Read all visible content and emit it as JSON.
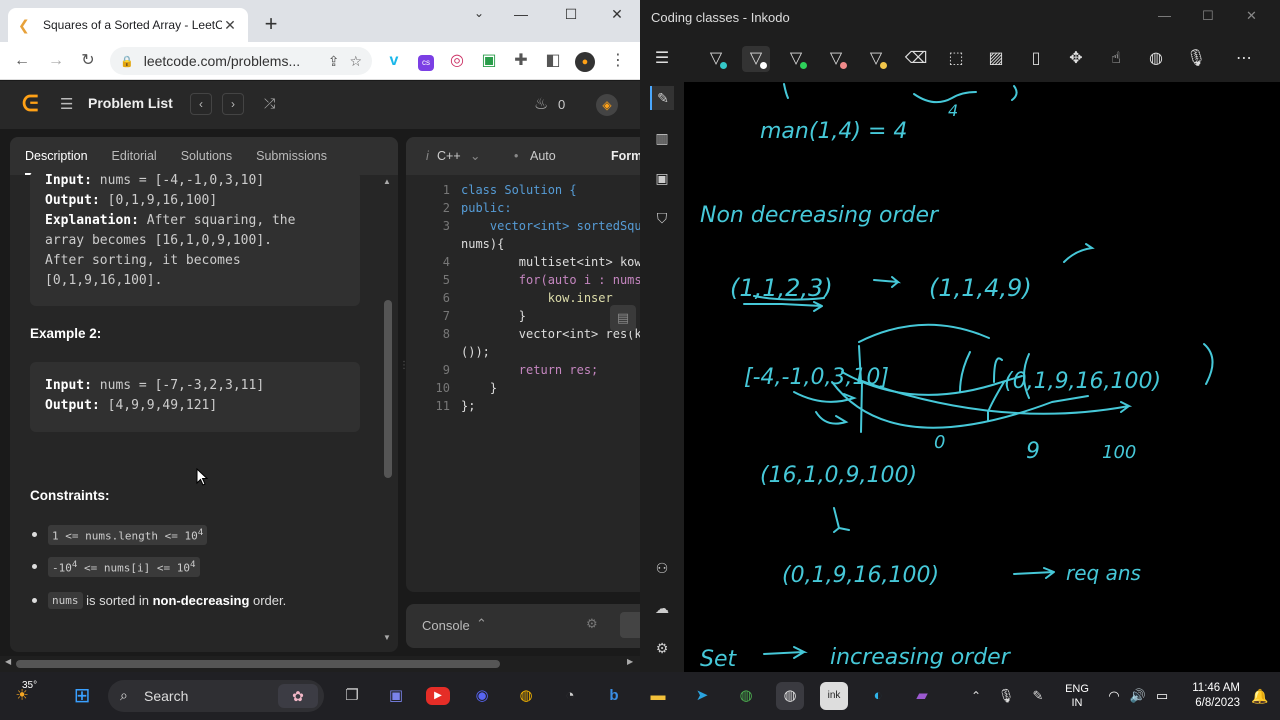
{
  "chrome": {
    "tab_title": "Squares of a Sorted Array - LeetC",
    "url": "leetcode.com/problems...",
    "new_tab": "+",
    "minimize": "—",
    "maximize": "☐",
    "close": "✕"
  },
  "leetcode": {
    "nav": {
      "problem_list": "Problem List",
      "streak": "0"
    },
    "tabs": [
      "Description",
      "Editorial",
      "Solutions",
      "Submissions"
    ],
    "example1": {
      "input_label": "Input:",
      "input_value": " nums = [-4,-1,0,3,10]",
      "output_label": "Output:",
      "output_value": " [0,1,9,16,100]",
      "explanation_label": "Explanation:",
      "explanation_lines": [
        " After squaring, the",
        "array becomes [16,1,0,9,100].",
        "After sorting, it becomes",
        "[0,1,9,16,100]."
      ]
    },
    "example2": {
      "heading": "Example 2:",
      "input_label": "Input:",
      "input_value": " nums = [-7,-3,2,3,11]",
      "output_label": "Output:",
      "output_value": " [4,9,9,49,121]"
    },
    "constraints": {
      "heading": "Constraints:",
      "c1": "1 <= nums.length <= 10",
      "c1_sup": "4",
      "c2_pre": "-10",
      "c2_sup1": "4",
      "c2_mid": " <= nums[i] <= 10",
      "c2_sup2": "4",
      "c3_code": "nums",
      "c3_text1": " is sorted in ",
      "c3_bold": "non-decreasing",
      "c3_text2": " order."
    },
    "editor": {
      "language": "C++",
      "mode": "Auto",
      "format": "Form",
      "lines": [
        "class Solution {",
        "public:",
        "    vector<int> sortedSqu",
        "nums){",
        "        multiset<int> kow",
        "        for(auto i : nums",
        "            kow.inser",
        "        }",
        "        vector<int> res(k",
        "());",
        "        return res;",
        "    }",
        "};"
      ],
      "line_numbers": [
        "1",
        "2",
        "3",
        "",
        "4",
        "5",
        "6",
        "7",
        "8",
        "",
        "9",
        "10",
        "11"
      ]
    },
    "console": "Console"
  },
  "inkodo": {
    "title": "Coding classes - Inkodo",
    "notes": {
      "n1": "man(1,4) = 4",
      "n2": "Non decreasing order",
      "n3": "(1,1,2,3)",
      "n4": "(1,1,4,9)",
      "n5": "[-4,-1,0,3,10]",
      "n6": "(0,1,9,16,100)",
      "n7a": "0",
      "n7b": "9",
      "n7c": "100",
      "n8": "(16,1,0,9,100)",
      "n9": "(0,1,9,16,100)",
      "n10": "req ans",
      "n11": "Set",
      "n12": "increasing order",
      "n13": "4"
    }
  },
  "taskbar": {
    "temp": "35°",
    "search": "Search",
    "lang1": "ENG",
    "lang2": "IN",
    "time": "11:46 AM",
    "date": "6/8/2023"
  },
  "colors": {
    "ink": "#46c8d8",
    "leetcode_accent": "#ffa116"
  }
}
